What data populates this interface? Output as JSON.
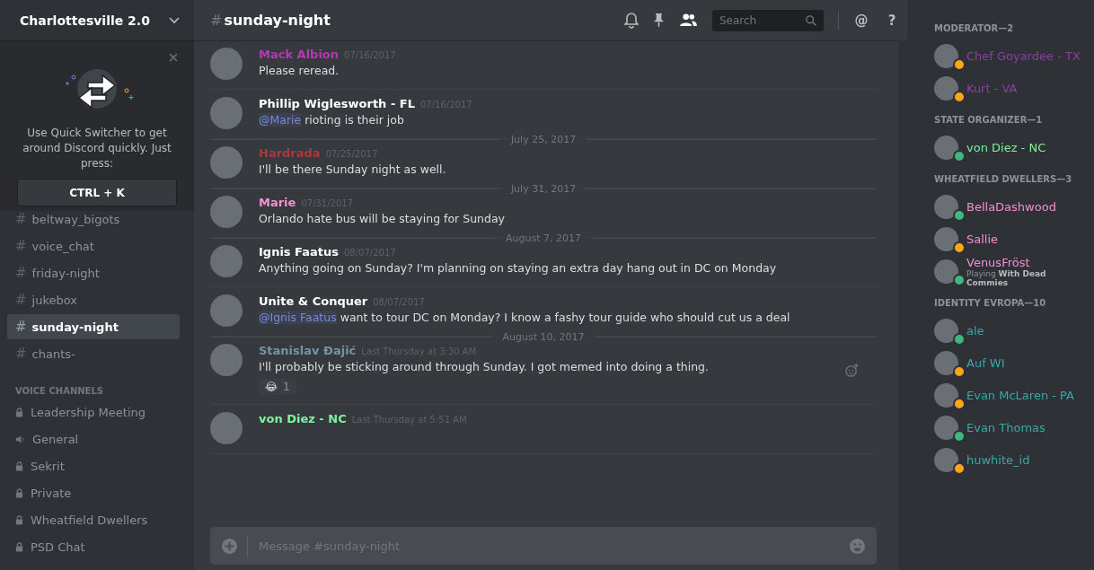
{
  "server": {
    "name": "Charlottesville 2.0"
  },
  "quick_switcher": {
    "text": "Use Quick Switcher to get around Discord quickly. Just press:",
    "shortcut": "CTRL + K"
  },
  "channels": [
    {
      "kind": "text",
      "prefix": "#",
      "name": "beltway_bigots",
      "selected": false
    },
    {
      "kind": "text",
      "prefix": "#",
      "name": "voice_chat",
      "selected": false
    },
    {
      "kind": "text",
      "prefix": "#",
      "name": "friday-night",
      "selected": false
    },
    {
      "kind": "text",
      "prefix": "#",
      "name": "jukebox",
      "selected": false
    },
    {
      "kind": "text",
      "prefix": "#",
      "name": "sunday-night",
      "selected": true
    },
    {
      "kind": "text",
      "prefix": "#",
      "name": "chants-",
      "selected": false
    }
  ],
  "voice_heading": "VOICE CHANNELS",
  "voice_channels": [
    {
      "kind": "locked",
      "name": "Leadership Meeting"
    },
    {
      "kind": "speaker",
      "name": "General"
    },
    {
      "kind": "locked",
      "name": "Sekrit"
    },
    {
      "kind": "locked",
      "name": "Private"
    },
    {
      "kind": "locked",
      "name": "Wheatfield Dwellers"
    },
    {
      "kind": "locked",
      "name": "PSD Chat"
    }
  ],
  "header": {
    "prefix": "#",
    "channel": "sunday-night",
    "search_placeholder": "Search",
    "glyphs": [
      "@",
      "?"
    ]
  },
  "messages": [
    {
      "kind": "message",
      "author": "Mack Albion",
      "color": "#b53ab5",
      "time": "07/16/2017",
      "text": "Please reread.",
      "hovered": false
    },
    {
      "kind": "message",
      "author": "Phillip Wiglesworth - FL",
      "color": "#ffffff",
      "time": "07/16/2017",
      "mention": "@Marie",
      "text": "rioting is their job",
      "hovered": false
    },
    {
      "kind": "divider",
      "text": "July 25, 2017"
    },
    {
      "kind": "message",
      "author": "Hardrada",
      "color": "#a63b3b",
      "time": "07/25/2017",
      "text": "I'll be there Sunday night as well.",
      "hovered": false
    },
    {
      "kind": "divider",
      "text": "July 31, 2017"
    },
    {
      "kind": "message",
      "author": "Marie",
      "color": "#f58fd0",
      "time": "07/31/2017",
      "text": "Orlando hate bus will be staying for Sunday",
      "hovered": false
    },
    {
      "kind": "divider",
      "text": "August 7, 2017"
    },
    {
      "kind": "message",
      "author": "Ignis Faatus",
      "color": "#ffffff",
      "time": "08/07/2017",
      "text": "Anything going on Sunday? I'm planning on staying an extra day hang out in DC on Monday",
      "hovered": false
    },
    {
      "kind": "message",
      "author": "Unite & Conquer",
      "color": "#ffffff",
      "time": "08/07/2017",
      "mention": "@Ignis Faatus",
      "text": "want to tour DC on Monday? I know a fashy tour guide who should cut us a deal",
      "hovered": false
    },
    {
      "kind": "divider",
      "text": "August 10, 2017"
    },
    {
      "kind": "message",
      "author": "Stanislav Đajić",
      "color": "#7494a6",
      "time": "Last Thursday at 3:30 AM",
      "text": "I'll probably be sticking around through Sunday. I got memed into doing a thing.",
      "reaction": {
        "emoji": "😂",
        "count": "1"
      },
      "hovered": true
    },
    {
      "kind": "message",
      "author": "von Diez - NC",
      "color": "#7ef29d",
      "time": "Last Thursday at 5:51 AM",
      "hovered": false
    }
  ],
  "composer": {
    "placeholder": "Message #sunday-night"
  },
  "member_groups": [
    {
      "title": "MODERATOR—2",
      "members": [
        {
          "name": "Chef Goyardee - TX",
          "color": "#8c3fa5",
          "presence": {
            "color": "#faa61a"
          }
        },
        {
          "name": "Kurt - VA",
          "color": "#8c3fa5",
          "presence": {
            "color": "#faa61a"
          }
        }
      ]
    },
    {
      "title": "STATE ORGANIZER—1",
      "members": [
        {
          "name": "von Diez - NC",
          "color": "#7ef29d",
          "presence": {
            "color": "#43b581"
          }
        }
      ]
    },
    {
      "title": "WHEATFIELD DWELLERS—3",
      "members": [
        {
          "name": "BellaDashwood",
          "color": "#f58fd0",
          "presence": {
            "color": "#43b581"
          }
        },
        {
          "name": "Sallie",
          "color": "#f58fd0",
          "presence": {
            "color": "#faa61a"
          }
        },
        {
          "name": "VenusFröst",
          "color": "#f58fd0",
          "presence": {
            "color": "#43b581"
          },
          "activity": "Playing **With Dead Commies**"
        }
      ]
    },
    {
      "title": "IDENTITY EVROPA—10",
      "members": [
        {
          "name": "ale",
          "color": "#3aa8a8",
          "presence": {
            "color": "#43b581"
          }
        },
        {
          "name": "Auf WI",
          "color": "#3aa8a8",
          "presence": {
            "color": "#faa61a"
          }
        },
        {
          "name": "Evan McLaren - PA",
          "color": "#3aa8a8",
          "presence": {
            "color": "#faa61a"
          }
        },
        {
          "name": "Evan Thomas",
          "color": "#3aa8a8",
          "presence": {
            "color": "#43b581"
          }
        },
        {
          "name": "huwhite_id",
          "color": "#3aa8a8",
          "presence": {
            "color": "#faa61a"
          }
        }
      ]
    }
  ]
}
